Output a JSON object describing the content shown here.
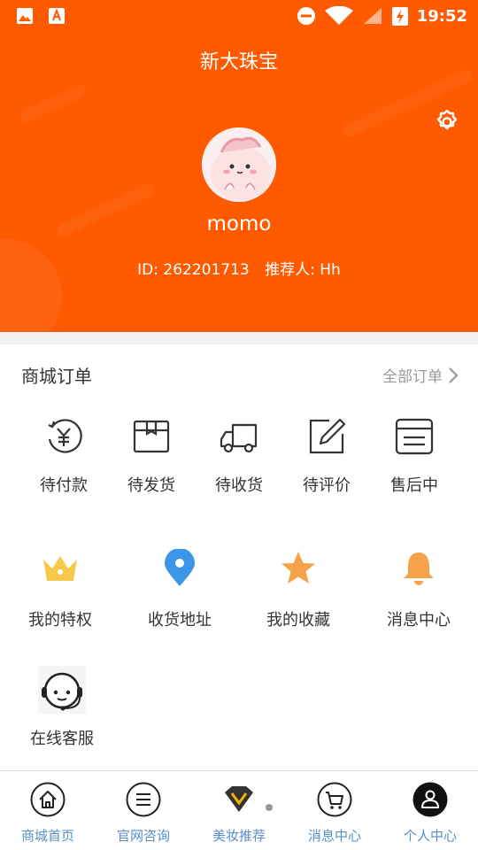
{
  "status_bar": {
    "time": "19:52"
  },
  "header": {
    "title": "新大珠宝",
    "username": "momo",
    "id_text": "ID: 262201713",
    "referrer_text": "推荐人: Hh"
  },
  "orders": {
    "title": "商城订单",
    "all_label": "全部订单",
    "items": [
      {
        "label": "待付款",
        "icon": "yen-refresh-icon"
      },
      {
        "label": "待发货",
        "icon": "package-box-icon"
      },
      {
        "label": "待收货",
        "icon": "delivery-truck-icon"
      },
      {
        "label": "待评价",
        "icon": "edit-review-icon"
      },
      {
        "label": "售后中",
        "icon": "after-sales-icon"
      }
    ]
  },
  "features": [
    {
      "label": "我的特权",
      "icon": "crown-icon",
      "color": "#f7c94b"
    },
    {
      "label": "收货地址",
      "icon": "location-pin-icon",
      "color": "#3b96e8"
    },
    {
      "label": "我的收藏",
      "icon": "star-icon",
      "color": "#f5a24a"
    },
    {
      "label": "消息中心",
      "icon": "bell-icon",
      "color": "#f5a24a"
    }
  ],
  "service": {
    "label": "在线客服",
    "icon": "customer-service-icon"
  },
  "tabbar": [
    {
      "label": "商城首页",
      "icon": "home-icon"
    },
    {
      "label": "官网咨询",
      "icon": "menu-lines-icon"
    },
    {
      "label": "美妆推荐",
      "icon": "diamond-icon"
    },
    {
      "label": "消息中心",
      "icon": "cart-icon"
    },
    {
      "label": "个人中心",
      "icon": "user-icon"
    }
  ],
  "colors": {
    "primary": "#ff5a00",
    "tab_label": "#5a8dc8"
  }
}
